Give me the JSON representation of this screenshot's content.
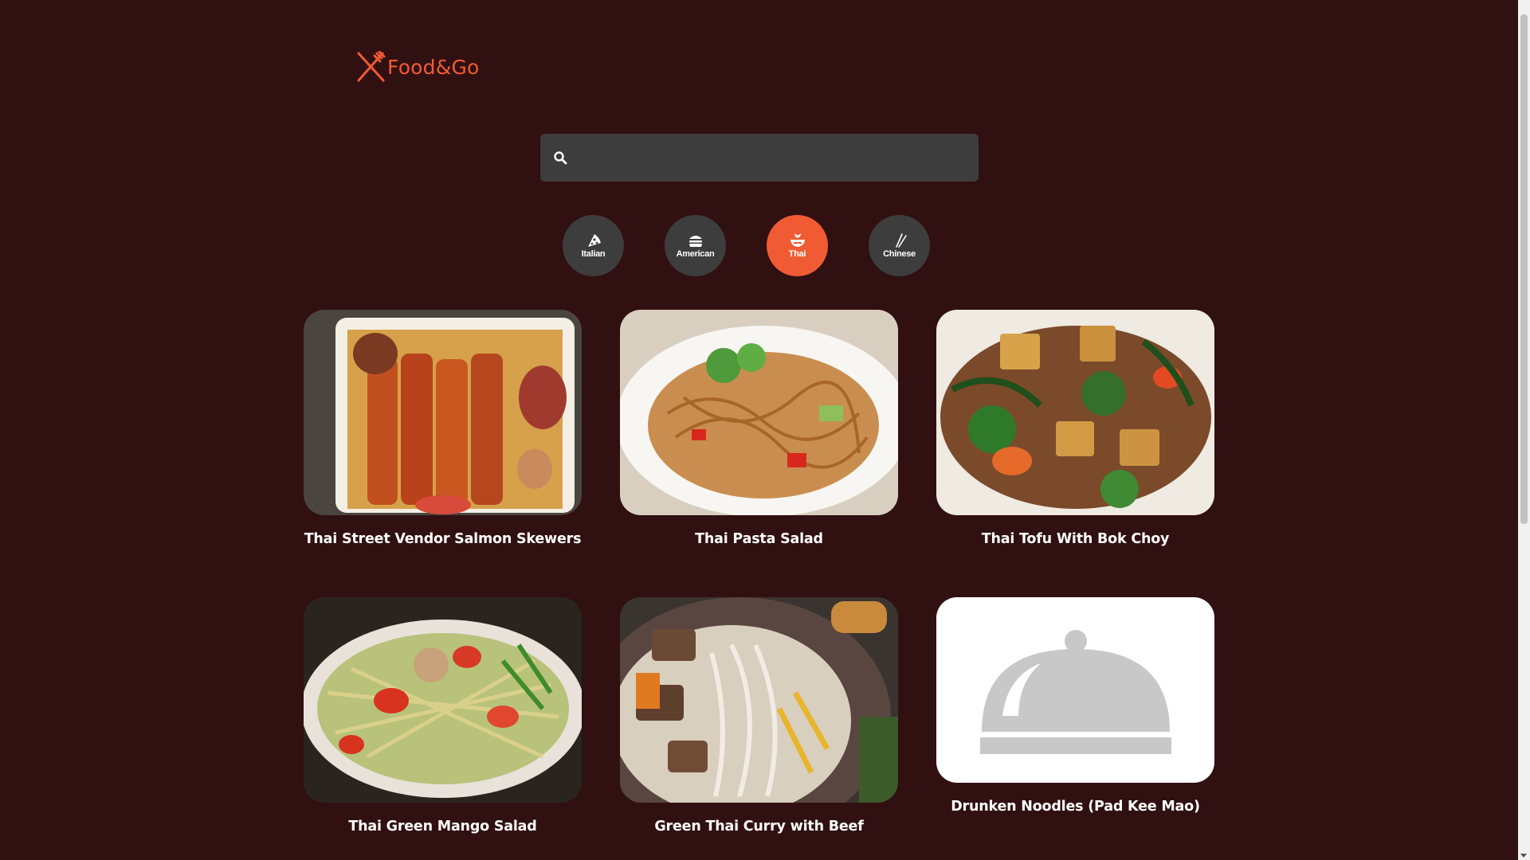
{
  "brand": {
    "name": "Food&Go",
    "icon": "fork-knife-icon",
    "color": "#f05b34"
  },
  "search": {
    "placeholder": "",
    "value": "",
    "icon": "search-icon"
  },
  "categories": [
    {
      "label": "Italian",
      "icon": "pizza-icon",
      "active": false
    },
    {
      "label": "American",
      "icon": "burger-icon",
      "active": false
    },
    {
      "label": "Thai",
      "icon": "noodle-bowl-icon",
      "active": true
    },
    {
      "label": "Chinese",
      "icon": "chopsticks-icon",
      "active": false
    }
  ],
  "recipes": [
    {
      "title": "Thai Street Vendor Salmon Skewers",
      "image": "salmon-skewers-photo"
    },
    {
      "title": "Thai Pasta Salad",
      "image": "pasta-salad-photo"
    },
    {
      "title": "Thai Tofu With Bok Choy",
      "image": "tofu-bok-choy-photo"
    },
    {
      "title": "Thai Green Mango Salad",
      "image": "green-mango-salad-photo"
    },
    {
      "title": "Green Thai Curry with Beef",
      "image": "green-curry-beef-photo"
    },
    {
      "title": "Drunken Noodles (Pad Kee Mao)",
      "image": "cloche-placeholder-icon"
    }
  ],
  "colors": {
    "background": "#311011",
    "accent": "#f05b34",
    "control": "#3d3d3d"
  }
}
